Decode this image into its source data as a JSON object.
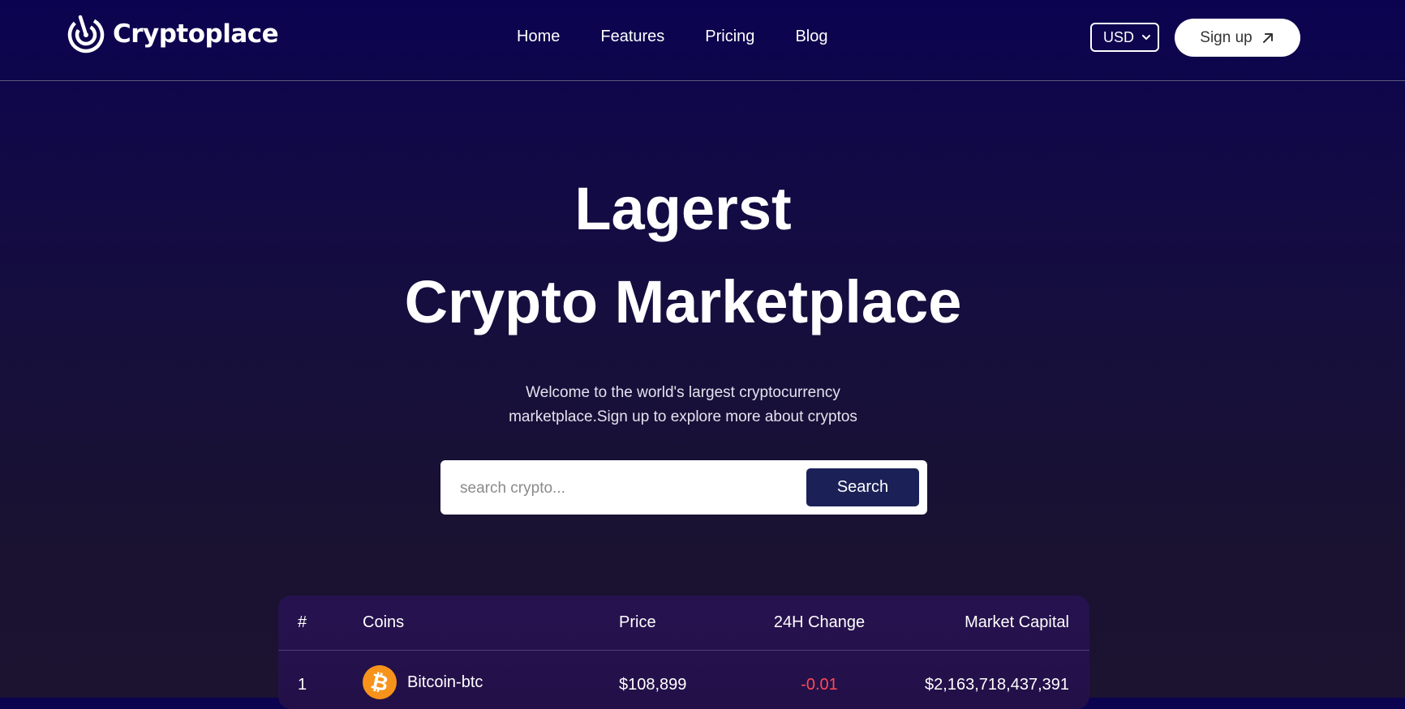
{
  "brand": {
    "name": "Cryptoplace",
    "icon": "logo-swirl-icon"
  },
  "nav": {
    "items": [
      {
        "label": "Home"
      },
      {
        "label": "Features"
      },
      {
        "label": "Pricing"
      },
      {
        "label": "Blog"
      }
    ]
  },
  "currency": {
    "selected": "USD",
    "icon": "chevron-down-icon"
  },
  "signup": {
    "label": "Sign up",
    "icon": "arrow-up-right-icon"
  },
  "hero": {
    "title_line1": "Lagerst",
    "title_line2": "Crypto Marketplace",
    "subtitle_line1": "Welcome to the world's largest cryptocurrency",
    "subtitle_line2": "marketplace.Sign up to explore more about cryptos"
  },
  "search": {
    "placeholder": "search crypto...",
    "value": "",
    "button_label": "Search"
  },
  "table": {
    "columns": [
      "#",
      "Coins",
      "Price",
      "24H Change",
      "Market Capital"
    ],
    "rows": [
      {
        "rank": "1",
        "coin": "Bitcoin-btc",
        "coin_icon": "bitcoin-icon",
        "price": "$108,899",
        "change": "-0.01",
        "market_cap": "$2,163,718,437,391"
      }
    ]
  },
  "colors": {
    "background_top": "#0b0350",
    "background_bottom": "#1b1330",
    "search_button": "#1b2157",
    "table_bg": "#26124f",
    "negative_change": "#ff4a55",
    "bitcoin": "#f7931a"
  }
}
